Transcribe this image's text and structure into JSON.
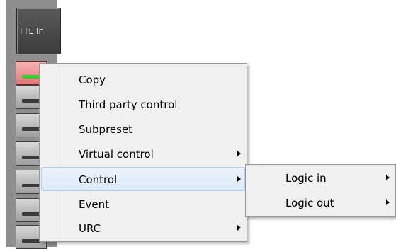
{
  "header": {
    "label": "TTL In"
  },
  "indicators": [
    {
      "state": "on"
    },
    {
      "state": "off"
    },
    {
      "state": "off"
    },
    {
      "state": "off"
    },
    {
      "state": "off"
    },
    {
      "state": "off"
    },
    {
      "state": "off"
    },
    {
      "state": "off"
    }
  ],
  "menu": {
    "items": [
      {
        "label": "Copy",
        "has_submenu": false
      },
      {
        "label": "Third party control",
        "has_submenu": false
      },
      {
        "label": "Subpreset",
        "has_submenu": false
      },
      {
        "label": "Virtual control",
        "has_submenu": true
      },
      {
        "label": "Control",
        "has_submenu": true,
        "highlighted": true
      },
      {
        "label": "Event",
        "has_submenu": false
      },
      {
        "label": "URC",
        "has_submenu": true
      }
    ]
  },
  "submenu": {
    "items": [
      {
        "label": "Logic in",
        "has_submenu": true
      },
      {
        "label": "Logic out",
        "has_submenu": true
      }
    ]
  },
  "colors": {
    "menu_bg": "#f0f0f0",
    "highlight": "#dceafa",
    "indicator_on": "#e27777",
    "led_green": "#2fd02f"
  }
}
